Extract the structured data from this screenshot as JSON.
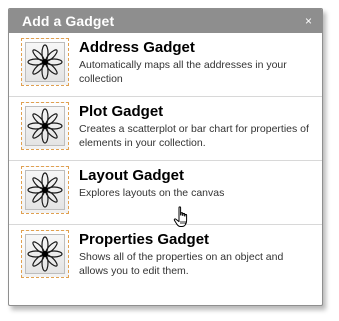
{
  "dialog": {
    "title": "Add a Gadget",
    "close_glyph": "×",
    "colors": {
      "titlebar": "#8e8e8e",
      "icon_border": "#e0a050"
    }
  },
  "gadgets": [
    {
      "name": "Address Gadget",
      "description": "Automatically maps all the addresses in your collection",
      "icon": "gadget-star-icon"
    },
    {
      "name": "Plot Gadget",
      "description": "Creates a scatterplot or bar chart for properties of elements in your collection.",
      "icon": "gadget-star-icon"
    },
    {
      "name": "Layout Gadget",
      "description": "Explores layouts on the canvas",
      "icon": "gadget-star-icon"
    },
    {
      "name": "Properties Gadget",
      "description": "Shows all of the properties on an object and allows you to edit them.",
      "icon": "gadget-star-icon"
    }
  ],
  "cursor": {
    "icon": "hand-pointer-icon"
  }
}
